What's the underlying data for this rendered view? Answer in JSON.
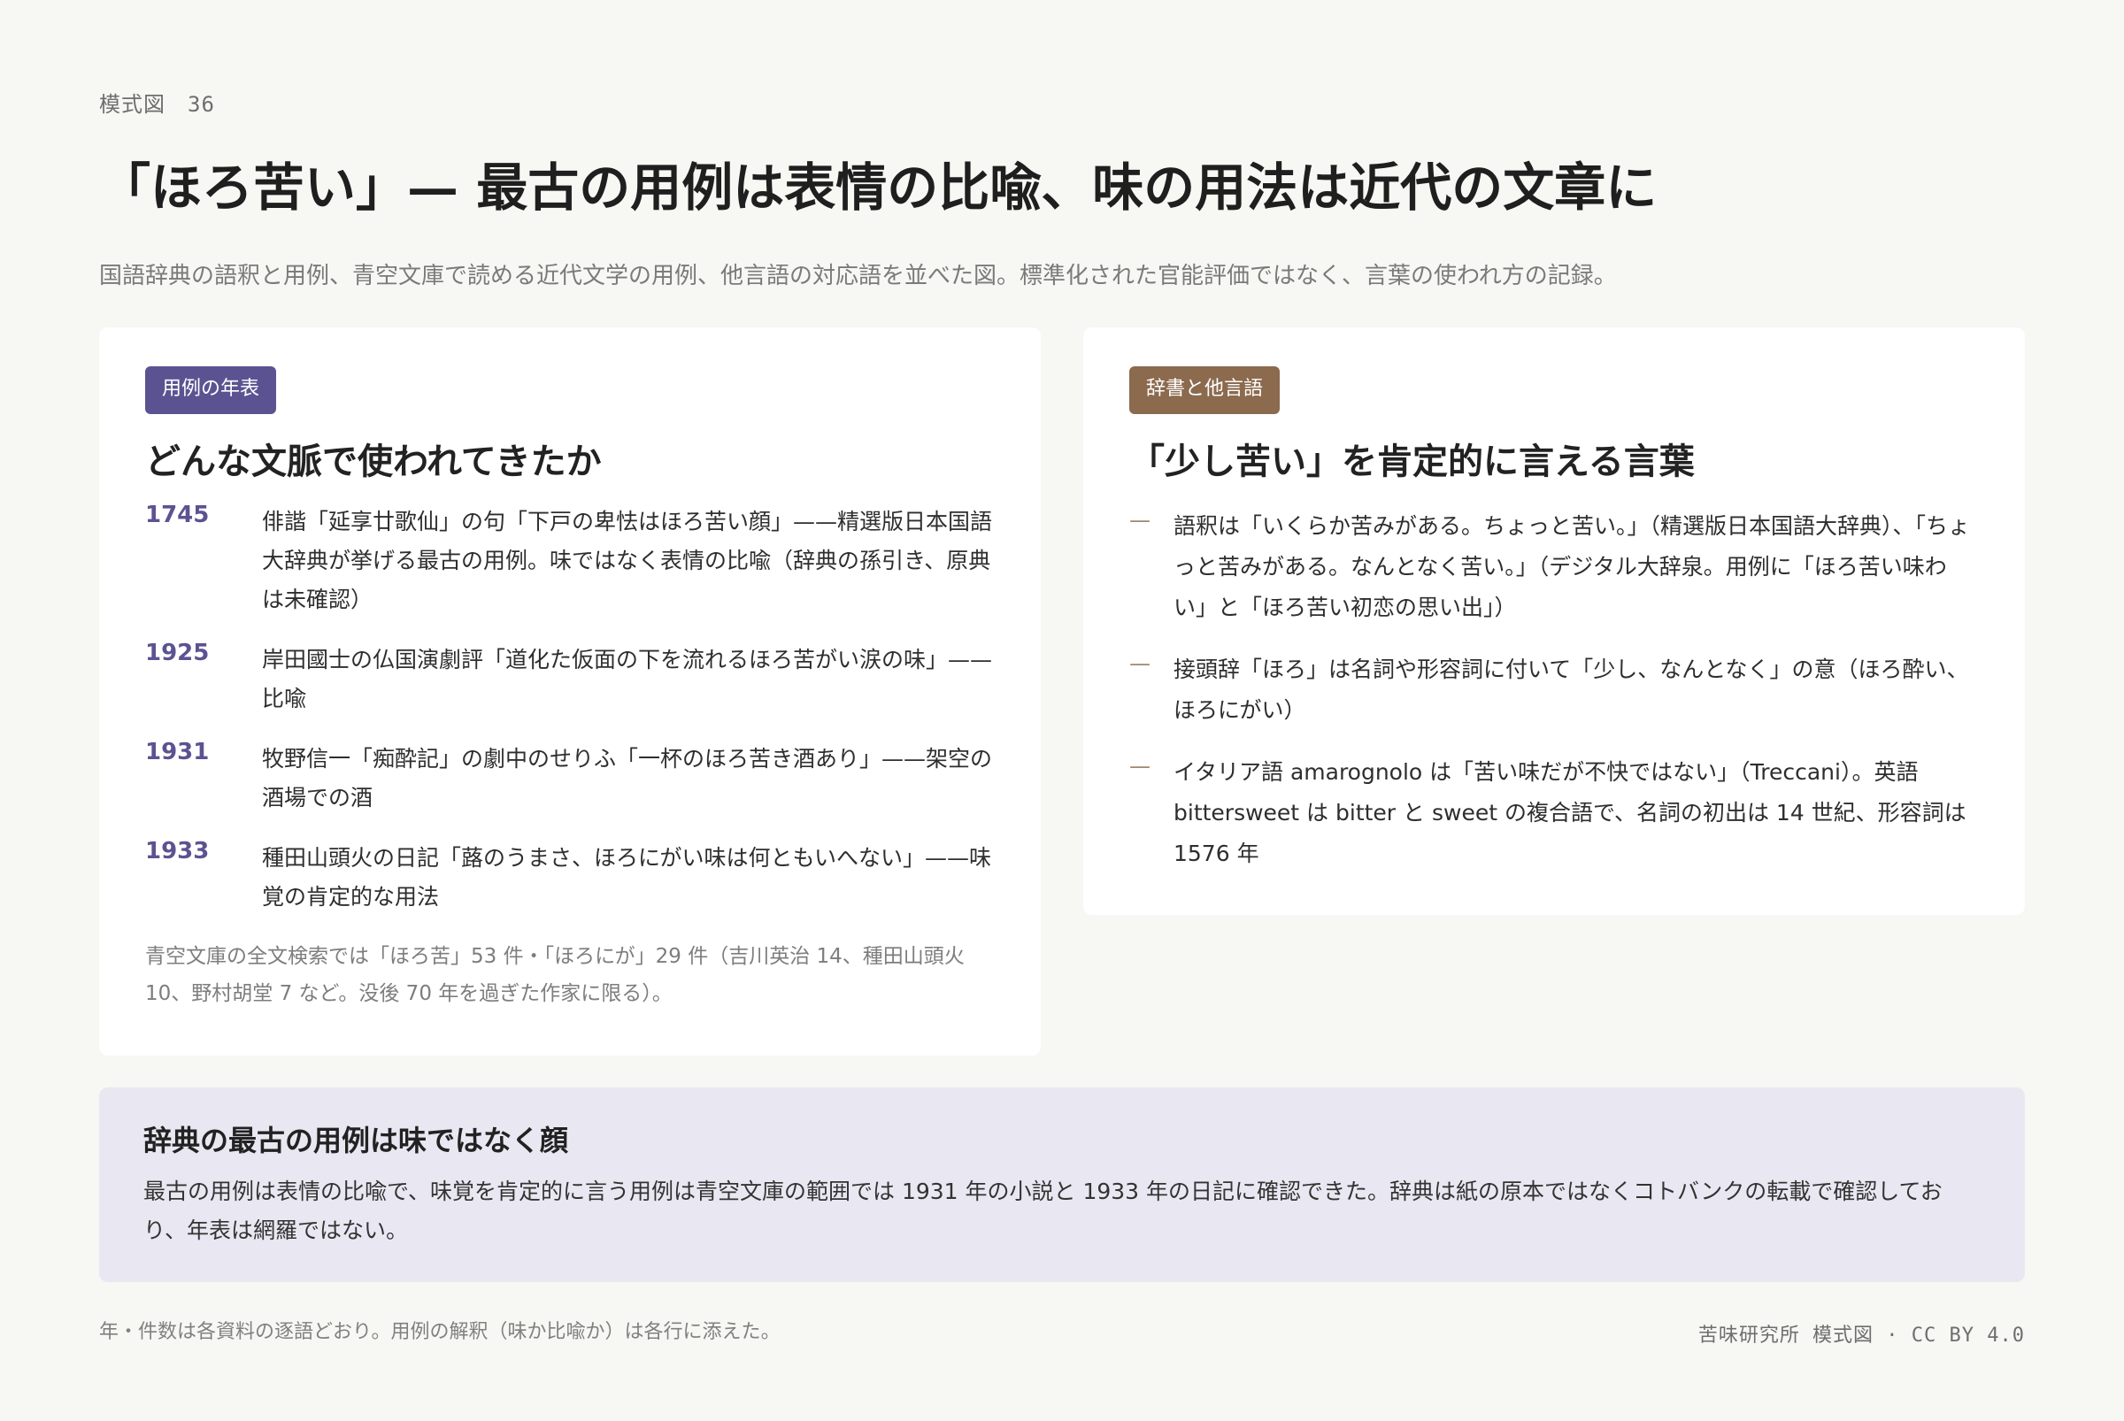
{
  "figure_label": "模式図　36",
  "title": "「ほろ苦い」— 最古の用例は表情の比喩、味の用法は近代の文章に",
  "lede": "国語辞典の語釈と用例、青空文庫で読める近代文学の用例、他言語の対応語を並べた図。標準化された官能評価ではなく、言葉の使われ方の記録。",
  "timeline_card": {
    "tag": "用例の年表",
    "heading": "どんな文脈で使われてきたか",
    "entries": [
      {
        "year": "1745",
        "text": "俳諧「延享廿歌仙」の句「下戸の卑怯はほろ苦い顔」——精選版日本国語大辞典が挙げる最古の用例。味ではなく表情の比喩（辞典の孫引き、原典は未確認）"
      },
      {
        "year": "1925",
        "text": "岸田國士の仏国演劇評「道化た仮面の下を流れるほろ苦がい涙の味」——比喩"
      },
      {
        "year": "1931",
        "text": "牧野信一「痴酔記」の劇中のせりふ「一杯のほろ苦き酒あり」——架空の酒場での酒"
      },
      {
        "year": "1933",
        "text": "種田山頭火の日記「蕗のうまさ、ほろにがい味は何ともいへない」——味覚の肯定的な用法"
      }
    ],
    "note": "青空文庫の全文検索では「ほろ苦」53 件・「ほろにが」29 件（吉川英治 14、種田山頭火 10、野村胡堂 7 など。没後 70 年を過ぎた作家に限る）。"
  },
  "dictionary_card": {
    "tag": "辞書と他言語",
    "heading": "「少し苦い」を肯定的に言える言葉",
    "dash": "—",
    "items": [
      "語釈は「いくらか苦みがある。ちょっと苦い。」（精選版日本国語大辞典）、「ちょっと苦みがある。なんとなく苦い。」（デジタル大辞泉。用例に「ほろ苦い味わい」と「ほろ苦い初恋の思い出」）",
      "接頭辞「ほろ」は名詞や形容詞に付いて「少し、なんとなく」の意（ほろ酔い、ほろにがい）",
      "イタリア語 amarognolo は「苦い味だが不快ではない」（Treccani）。英語 bittersweet は bitter と sweet の複合語で、名詞の初出は 14 世紀、形容詞は 1576 年"
    ]
  },
  "summary": {
    "title": "辞典の最古の用例は味ではなく顔",
    "body": "最古の用例は表情の比喩で、味覚を肯定的に言う用例は青空文庫の範囲では 1931 年の小説と 1933 年の日記に確認できた。辞典は紙の原本ではなくコトバンクの転載で確認しており、年表は網羅ではない。"
  },
  "footer": {
    "note": "年・件数は各資料の逐語どおり。用例の解釈（味か比喩か）は各行に添えた。",
    "credit": "苦味研究所 模式図 · CC BY 4.0"
  },
  "colors": {
    "accent_purple": "#5b5391",
    "accent_brown": "#8b6a4e",
    "summary_bg": "#e9e8f2",
    "page_bg": "#f7f7f3"
  }
}
